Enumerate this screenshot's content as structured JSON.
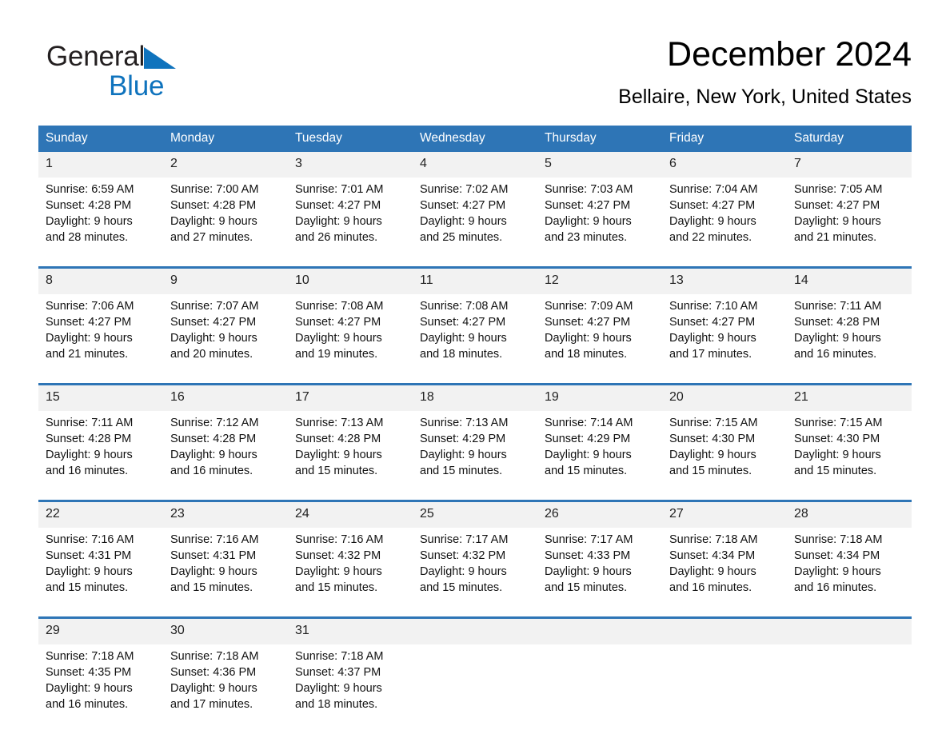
{
  "brand": {
    "name_part1": "General",
    "name_part2": "Blue",
    "triangle_color": "#0f73bd",
    "text_color": "#231f20"
  },
  "header": {
    "month_title": "December 2024",
    "location": "Bellaire, New York, United States"
  },
  "theme": {
    "header_blue": "#2e75b6",
    "daynum_band": "#f2f2f2",
    "page_background": "#ffffff",
    "text": "#000000"
  },
  "calendar": {
    "day_names": [
      "Sunday",
      "Monday",
      "Tuesday",
      "Wednesday",
      "Thursday",
      "Friday",
      "Saturday"
    ],
    "weeks": [
      [
        {
          "day": "1",
          "lines": [
            "Sunrise: 6:59 AM",
            "Sunset: 4:28 PM",
            "Daylight: 9 hours",
            "and 28 minutes."
          ]
        },
        {
          "day": "2",
          "lines": [
            "Sunrise: 7:00 AM",
            "Sunset: 4:28 PM",
            "Daylight: 9 hours",
            "and 27 minutes."
          ]
        },
        {
          "day": "3",
          "lines": [
            "Sunrise: 7:01 AM",
            "Sunset: 4:27 PM",
            "Daylight: 9 hours",
            "and 26 minutes."
          ]
        },
        {
          "day": "4",
          "lines": [
            "Sunrise: 7:02 AM",
            "Sunset: 4:27 PM",
            "Daylight: 9 hours",
            "and 25 minutes."
          ]
        },
        {
          "day": "5",
          "lines": [
            "Sunrise: 7:03 AM",
            "Sunset: 4:27 PM",
            "Daylight: 9 hours",
            "and 23 minutes."
          ]
        },
        {
          "day": "6",
          "lines": [
            "Sunrise: 7:04 AM",
            "Sunset: 4:27 PM",
            "Daylight: 9 hours",
            "and 22 minutes."
          ]
        },
        {
          "day": "7",
          "lines": [
            "Sunrise: 7:05 AM",
            "Sunset: 4:27 PM",
            "Daylight: 9 hours",
            "and 21 minutes."
          ]
        }
      ],
      [
        {
          "day": "8",
          "lines": [
            "Sunrise: 7:06 AM",
            "Sunset: 4:27 PM",
            "Daylight: 9 hours",
            "and 21 minutes."
          ]
        },
        {
          "day": "9",
          "lines": [
            "Sunrise: 7:07 AM",
            "Sunset: 4:27 PM",
            "Daylight: 9 hours",
            "and 20 minutes."
          ]
        },
        {
          "day": "10",
          "lines": [
            "Sunrise: 7:08 AM",
            "Sunset: 4:27 PM",
            "Daylight: 9 hours",
            "and 19 minutes."
          ]
        },
        {
          "day": "11",
          "lines": [
            "Sunrise: 7:08 AM",
            "Sunset: 4:27 PM",
            "Daylight: 9 hours",
            "and 18 minutes."
          ]
        },
        {
          "day": "12",
          "lines": [
            "Sunrise: 7:09 AM",
            "Sunset: 4:27 PM",
            "Daylight: 9 hours",
            "and 18 minutes."
          ]
        },
        {
          "day": "13",
          "lines": [
            "Sunrise: 7:10 AM",
            "Sunset: 4:27 PM",
            "Daylight: 9 hours",
            "and 17 minutes."
          ]
        },
        {
          "day": "14",
          "lines": [
            "Sunrise: 7:11 AM",
            "Sunset: 4:28 PM",
            "Daylight: 9 hours",
            "and 16 minutes."
          ]
        }
      ],
      [
        {
          "day": "15",
          "lines": [
            "Sunrise: 7:11 AM",
            "Sunset: 4:28 PM",
            "Daylight: 9 hours",
            "and 16 minutes."
          ]
        },
        {
          "day": "16",
          "lines": [
            "Sunrise: 7:12 AM",
            "Sunset: 4:28 PM",
            "Daylight: 9 hours",
            "and 16 minutes."
          ]
        },
        {
          "day": "17",
          "lines": [
            "Sunrise: 7:13 AM",
            "Sunset: 4:28 PM",
            "Daylight: 9 hours",
            "and 15 minutes."
          ]
        },
        {
          "day": "18",
          "lines": [
            "Sunrise: 7:13 AM",
            "Sunset: 4:29 PM",
            "Daylight: 9 hours",
            "and 15 minutes."
          ]
        },
        {
          "day": "19",
          "lines": [
            "Sunrise: 7:14 AM",
            "Sunset: 4:29 PM",
            "Daylight: 9 hours",
            "and 15 minutes."
          ]
        },
        {
          "day": "20",
          "lines": [
            "Sunrise: 7:15 AM",
            "Sunset: 4:30 PM",
            "Daylight: 9 hours",
            "and 15 minutes."
          ]
        },
        {
          "day": "21",
          "lines": [
            "Sunrise: 7:15 AM",
            "Sunset: 4:30 PM",
            "Daylight: 9 hours",
            "and 15 minutes."
          ]
        }
      ],
      [
        {
          "day": "22",
          "lines": [
            "Sunrise: 7:16 AM",
            "Sunset: 4:31 PM",
            "Daylight: 9 hours",
            "and 15 minutes."
          ]
        },
        {
          "day": "23",
          "lines": [
            "Sunrise: 7:16 AM",
            "Sunset: 4:31 PM",
            "Daylight: 9 hours",
            "and 15 minutes."
          ]
        },
        {
          "day": "24",
          "lines": [
            "Sunrise: 7:16 AM",
            "Sunset: 4:32 PM",
            "Daylight: 9 hours",
            "and 15 minutes."
          ]
        },
        {
          "day": "25",
          "lines": [
            "Sunrise: 7:17 AM",
            "Sunset: 4:32 PM",
            "Daylight: 9 hours",
            "and 15 minutes."
          ]
        },
        {
          "day": "26",
          "lines": [
            "Sunrise: 7:17 AM",
            "Sunset: 4:33 PM",
            "Daylight: 9 hours",
            "and 15 minutes."
          ]
        },
        {
          "day": "27",
          "lines": [
            "Sunrise: 7:18 AM",
            "Sunset: 4:34 PM",
            "Daylight: 9 hours",
            "and 16 minutes."
          ]
        },
        {
          "day": "28",
          "lines": [
            "Sunrise: 7:18 AM",
            "Sunset: 4:34 PM",
            "Daylight: 9 hours",
            "and 16 minutes."
          ]
        }
      ],
      [
        {
          "day": "29",
          "lines": [
            "Sunrise: 7:18 AM",
            "Sunset: 4:35 PM",
            "Daylight: 9 hours",
            "and 16 minutes."
          ]
        },
        {
          "day": "30",
          "lines": [
            "Sunrise: 7:18 AM",
            "Sunset: 4:36 PM",
            "Daylight: 9 hours",
            "and 17 minutes."
          ]
        },
        {
          "day": "31",
          "lines": [
            "Sunrise: 7:18 AM",
            "Sunset: 4:37 PM",
            "Daylight: 9 hours",
            "and 18 minutes."
          ]
        },
        {
          "day": "",
          "lines": []
        },
        {
          "day": "",
          "lines": []
        },
        {
          "day": "",
          "lines": []
        },
        {
          "day": "",
          "lines": []
        }
      ]
    ]
  }
}
